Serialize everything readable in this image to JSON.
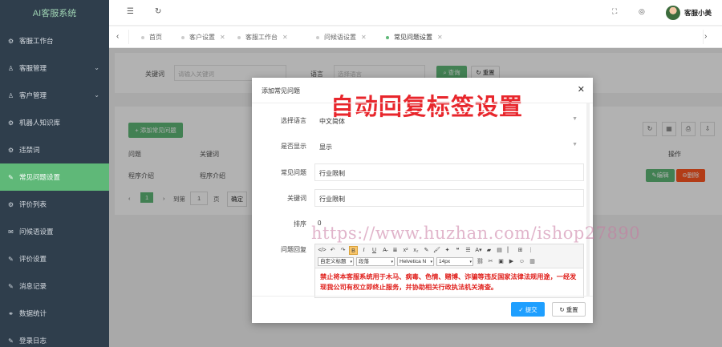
{
  "app": {
    "title": "AI客服系统"
  },
  "sidebar": {
    "items": [
      {
        "label": "客服工作台",
        "icon": "gear-icon",
        "expandable": false
      },
      {
        "label": "客服管理",
        "icon": "user-icon",
        "expandable": true
      },
      {
        "label": "客户管理",
        "icon": "user-icon",
        "expandable": true
      },
      {
        "label": "机器人知识库",
        "icon": "gear-icon",
        "expandable": false
      },
      {
        "label": "违禁词",
        "icon": "gear-icon",
        "expandable": false
      },
      {
        "label": "常见问题设置",
        "icon": "edit-icon",
        "expandable": false,
        "active": true
      },
      {
        "label": "评价列表",
        "icon": "gear-icon",
        "expandable": false
      },
      {
        "label": "问候语设置",
        "icon": "chat-icon",
        "expandable": false
      },
      {
        "label": "评价设置",
        "icon": "edit-icon",
        "expandable": false
      },
      {
        "label": "消息记录",
        "icon": "edit-icon",
        "expandable": false
      },
      {
        "label": "数据统计",
        "icon": "link-icon",
        "expandable": false
      },
      {
        "label": "登录日志",
        "icon": "edit-icon",
        "expandable": false
      }
    ]
  },
  "header": {
    "user_name": "客服小美"
  },
  "tabs": [
    {
      "label": "首页",
      "closable": false
    },
    {
      "label": "客户设置",
      "closable": true
    },
    {
      "label": "客服工作台",
      "closable": true
    },
    {
      "label": "问候语设置",
      "closable": true
    },
    {
      "label": "常见问题设置",
      "closable": true,
      "active": true
    }
  ],
  "search": {
    "keyword_label": "关键词",
    "keyword_placeholder": "请输入关键词",
    "language_label": "语言",
    "language_placeholder": "选择语言",
    "search_button": "查询",
    "reset_button": "重置"
  },
  "table": {
    "add_button": "+ 添加常见问题",
    "headers": [
      "问题",
      "关键词",
      "操作"
    ],
    "rows": [
      {
        "question": "程序介绍",
        "keyword": "程序介绍",
        "edit": "编辑",
        "delete": "删除"
      }
    ]
  },
  "pagination": {
    "current": "1",
    "goto_label": "到第",
    "page_value": "1",
    "page_unit": "页",
    "confirm": "确定"
  },
  "modal": {
    "title": "添加常见问题",
    "banner": "自动回复标签设置",
    "fields": [
      {
        "label": "选择语言",
        "value": "中文简体",
        "type": "select"
      },
      {
        "label": "是否显示",
        "value": "显示",
        "type": "select"
      },
      {
        "label": "常见问题",
        "value": "行业限制",
        "type": "input"
      },
      {
        "label": "关键词",
        "value": "行业限制",
        "type": "input"
      },
      {
        "label": "排序",
        "value": "0",
        "type": "plain"
      },
      {
        "label": "问题回复",
        "type": "editor"
      }
    ],
    "editor": {
      "custom_title": "自定义标题",
      "paragraph": "段落",
      "font_family": "Helvetica N",
      "font_size": "14px",
      "content": "禁止将本客服系统用于木马、病毒、色情、赌博、诈骗等违反国家法律法规用途，一经发现我公司有权立即终止服务，并协助相关行政执法机关清查。"
    },
    "submit": "提交",
    "reset": "重置"
  },
  "watermark": "https://www.huzhan.com/ishop27890",
  "colors": {
    "sidebar_bg": "#2f3e4c",
    "accent_green": "#5fb878",
    "primary_blue": "#1e9fff",
    "danger_red": "#ff5722",
    "banner_red": "#e8262c"
  }
}
